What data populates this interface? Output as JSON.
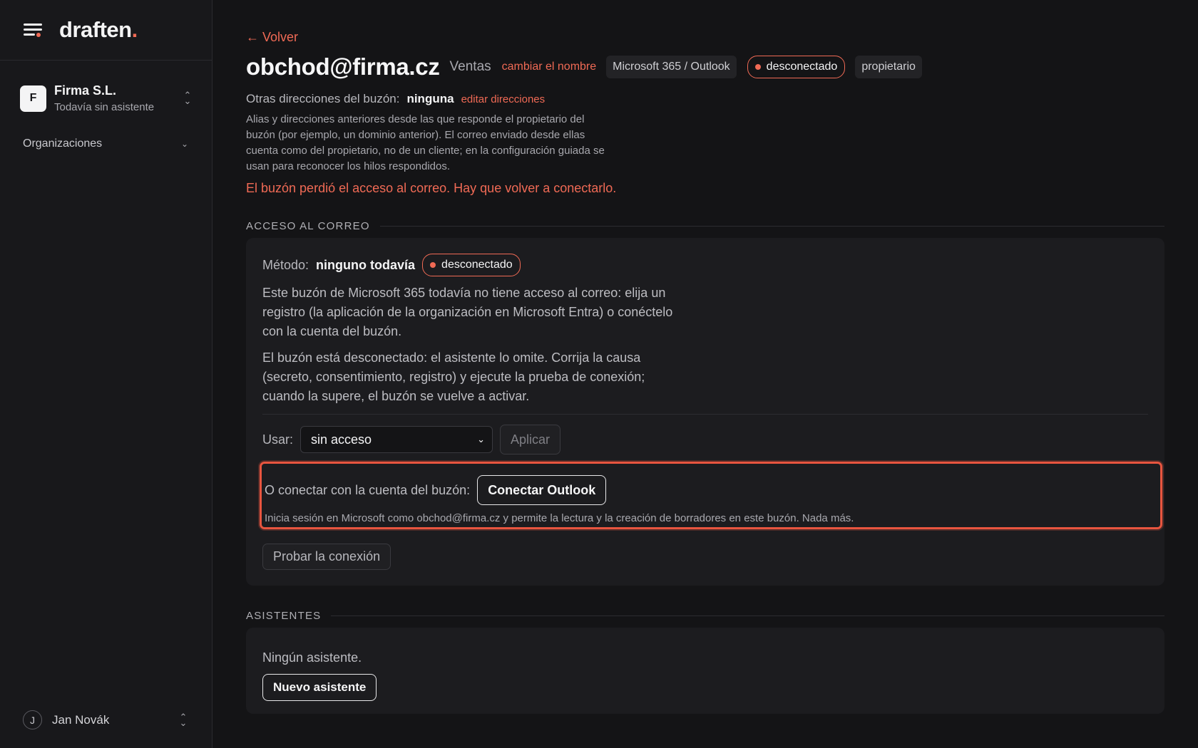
{
  "sidebar": {
    "logo_text": "draften",
    "logo_dot": ".",
    "org": {
      "initial": "F",
      "name": "Firma S.L.",
      "subtitle": "Todavía sin asistente"
    },
    "nav": {
      "organizations": "Organizaciones"
    },
    "user": {
      "initial": "J",
      "name": "Jan Novák"
    }
  },
  "header": {
    "back": "← Volver",
    "title": "obchod@firma.cz",
    "subtitle": "Ventas",
    "rename": "cambiar el nombre",
    "provider": "Microsoft 365 / Outlook",
    "status": "desconectado",
    "role": "propietario"
  },
  "addresses": {
    "label": "Otras direcciones del buzón:",
    "value": "ninguna",
    "edit": "editar direcciones",
    "help": "Alias y direcciones anteriores desde las que responde el propietario del buzón (por ejemplo, un dominio anterior). El correo enviado desde ellas cuenta como del propietario, no de un cliente; en la configuración guiada se usan para reconocer los hilos respondidos.",
    "warning": "El buzón perdió el acceso al correo. Hay que volver a conectarlo."
  },
  "access": {
    "section_title": "ACCESO AL CORREO",
    "method_label": "Método:",
    "method_value": "ninguno todavía",
    "status": "desconectado",
    "para1": "Este buzón de Microsoft 365 todavía no tiene acceso al correo: elija un registro (la aplicación de la organización en Microsoft Entra) o conéctelo con la cuenta del buzón.",
    "para2": "El buzón está desconectado: el asistente lo omite. Corrija la causa (secreto, consentimiento, registro) y ejecute la prueba de conexión; cuando la supere, el buzón se vuelve a activar.",
    "use_label": "Usar:",
    "use_value": "sin acceso",
    "apply": "Aplicar",
    "connect_label": "O conectar con la cuenta del buzón:",
    "connect_button": "Conectar Outlook",
    "connect_help": "Inicia sesión en Microsoft como obchod@firma.cz y permite la lectura y la creación de borradores en este buzón. Nada más.",
    "test_button": "Probar la conexión"
  },
  "assistants": {
    "section_title": "ASISTENTES",
    "empty": "Ningún asistente.",
    "new_button": "Nuevo asistente"
  },
  "colors": {
    "accent": "#f06a55",
    "background": "#141416",
    "sidebar": "#18181b"
  }
}
